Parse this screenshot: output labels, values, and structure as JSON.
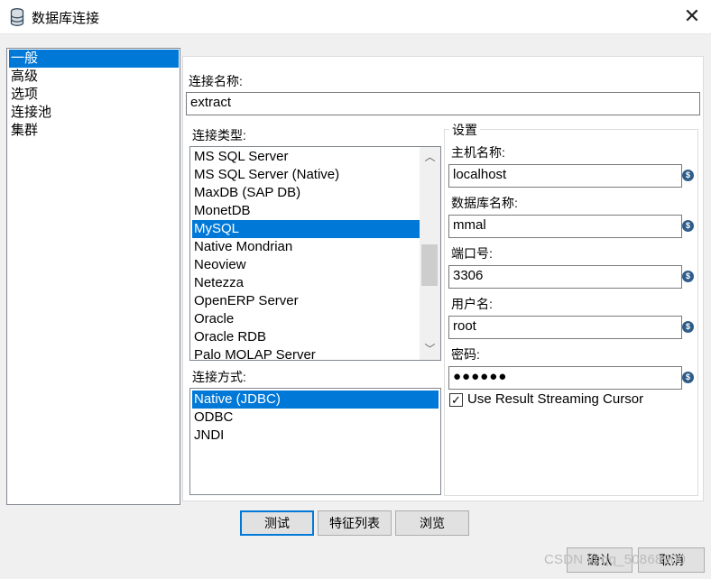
{
  "window": {
    "title": "数据库连接"
  },
  "nav": {
    "items": [
      "一般",
      "高级",
      "选项",
      "连接池",
      "集群"
    ],
    "selected_index": 0
  },
  "general": {
    "conn_name_label": "连接名称:",
    "conn_name_value": "extract",
    "conn_type_label": "连接类型:",
    "conn_types": [
      "MS SQL Server",
      "MS SQL Server (Native)",
      "MaxDB (SAP DB)",
      "MonetDB",
      "MySQL",
      "Native Mondrian",
      "Neoview",
      "Netezza",
      "OpenERP Server",
      "Oracle",
      "Oracle RDB",
      "Palo MOLAP Server"
    ],
    "conn_type_selected": "MySQL",
    "access_label": "连接方式:",
    "access_methods": [
      "Native (JDBC)",
      "ODBC",
      "JNDI"
    ],
    "access_selected": "Native (JDBC)"
  },
  "settings": {
    "title": "设置",
    "host_label": "主机名称:",
    "host_value": "localhost",
    "db_label": "数据库名称:",
    "db_value": "mmal",
    "port_label": "端口号:",
    "port_value": "3306",
    "user_label": "用户名:",
    "user_value": "root",
    "password_label": "密码:",
    "password_value": "●●●●●●",
    "streaming_label": "Use Result Streaming Cursor",
    "streaming_checked": true
  },
  "buttons": {
    "test": "测试",
    "features": "特征列表",
    "explore": "浏览",
    "ok": "确认",
    "cancel": "取消"
  },
  "watermark": "CSDN @qq_50868900",
  "colors": {
    "selection": "#0078d7",
    "variable_icon": "#2f5d8a"
  }
}
